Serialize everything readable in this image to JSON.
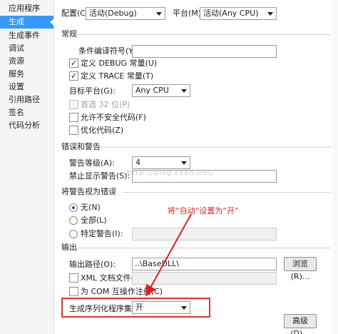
{
  "sidebar": {
    "items": [
      {
        "label": "应用程序"
      },
      {
        "label": "生成"
      },
      {
        "label": "生成事件"
      },
      {
        "label": "调试"
      },
      {
        "label": "资源"
      },
      {
        "label": "服务"
      },
      {
        "label": "设置"
      },
      {
        "label": "引用路径"
      },
      {
        "label": "签名"
      },
      {
        "label": "代码分析"
      }
    ],
    "active": "生成"
  },
  "top": {
    "config_label": "配置(C):",
    "config_value": "活动(Debug)",
    "platform_label": "平台(M):",
    "platform_value": "活动(Any CPU)"
  },
  "general": {
    "title": "常规",
    "symbols_label": "条件编译符号(Y):",
    "symbols_value": "",
    "debug_const": "定义 DEBUG 常量(U)",
    "trace_const": "定义 TRACE 常量(T)",
    "target_label": "目标平台(G):",
    "target_value": "Any CPU",
    "prefer32": "首选 32 位(P)",
    "unsafe": "允许不安全代码(F)",
    "optimize": "优化代码(Z)"
  },
  "errors": {
    "title": "错误和警告",
    "level_label": "警告等级(A):",
    "level_value": "4",
    "suppress_label": "禁止显示警告(S):",
    "suppress_value": ""
  },
  "treat": {
    "title": "将警告视为错误",
    "none": "无(N)",
    "all": "全部(L)",
    "specific": "特定警告(I):",
    "specific_value": ""
  },
  "output": {
    "title": "输出",
    "path_label": "输出路径(O):",
    "path_value": "..\\BaseDLL\\",
    "browse": "浏览(R)...",
    "xml": "XML 文档文件(X):",
    "xml_value": "",
    "com": "为 COM 互操作注册(C)",
    "serial_label": "生成序列化程序集(E):",
    "serial_value": "开",
    "advanced": "高级(D)..."
  },
  "annotation": {
    "text": "将“自动”设置为“开”"
  },
  "watermark": "http://blog.csdn.net/",
  "colors": {
    "accent": "#3399ff",
    "annotation": "#e02020"
  }
}
